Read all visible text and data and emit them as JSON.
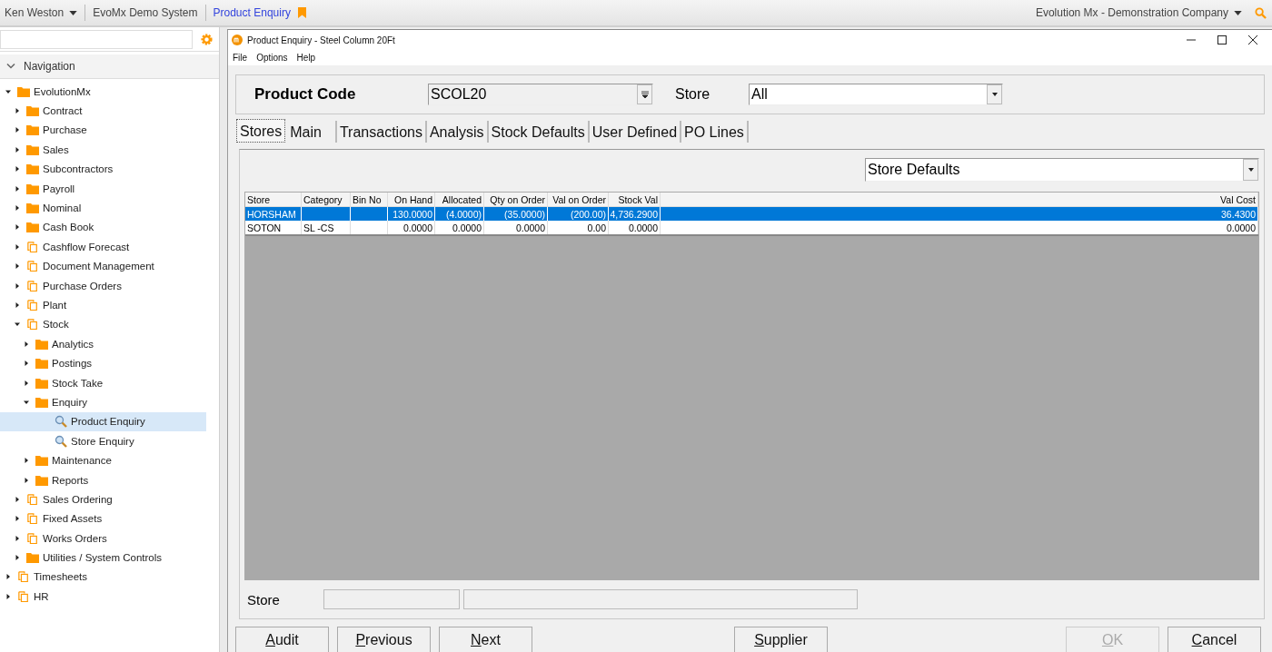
{
  "top_bar": {
    "user": "Ken Weston",
    "system": "EvoMx Demo System",
    "current": "Product Enquiry",
    "company": "Evolution Mx - Demonstration Company"
  },
  "sidebar": {
    "header": "Navigation",
    "tree": [
      {
        "label": "EvolutionMx",
        "kind": "folder",
        "expanded": true,
        "selected": false,
        "children": [
          {
            "label": "Contract",
            "kind": "folder",
            "expanded": false,
            "selected": false
          },
          {
            "label": "Purchase",
            "kind": "folder",
            "expanded": false,
            "selected": false
          },
          {
            "label": "Sales",
            "kind": "folder",
            "expanded": false,
            "selected": false
          },
          {
            "label": "Subcontractors",
            "kind": "folder",
            "expanded": false,
            "selected": false
          },
          {
            "label": "Payroll",
            "kind": "folder",
            "expanded": false,
            "selected": false
          },
          {
            "label": "Nominal",
            "kind": "folder",
            "expanded": false,
            "selected": false
          },
          {
            "label": "Cash Book",
            "kind": "folder",
            "expanded": false,
            "selected": false
          },
          {
            "label": "Cashflow Forecast",
            "kind": "module",
            "expanded": false,
            "selected": false
          },
          {
            "label": "Document Management",
            "kind": "module",
            "expanded": false,
            "selected": false
          },
          {
            "label": "Purchase Orders",
            "kind": "module",
            "expanded": false,
            "selected": false
          },
          {
            "label": "Plant",
            "kind": "module",
            "expanded": false,
            "selected": false
          },
          {
            "label": "Stock",
            "kind": "module",
            "expanded": true,
            "selected": false,
            "children": [
              {
                "label": "Analytics",
                "kind": "folder",
                "expanded": false,
                "selected": false
              },
              {
                "label": "Postings",
                "kind": "folder",
                "expanded": false,
                "selected": false
              },
              {
                "label": "Stock Take",
                "kind": "folder",
                "expanded": false,
                "selected": false
              },
              {
                "label": "Enquiry",
                "kind": "folder",
                "expanded": true,
                "selected": false,
                "children": [
                  {
                    "label": "Product Enquiry",
                    "kind": "search",
                    "selected": true
                  },
                  {
                    "label": "Store Enquiry",
                    "kind": "search",
                    "selected": false
                  }
                ]
              },
              {
                "label": "Maintenance",
                "kind": "folder",
                "expanded": false,
                "selected": false
              },
              {
                "label": "Reports",
                "kind": "folder",
                "expanded": false,
                "selected": false
              }
            ]
          },
          {
            "label": "Sales Ordering",
            "kind": "module",
            "expanded": false,
            "selected": false
          },
          {
            "label": "Fixed Assets",
            "kind": "module",
            "expanded": false,
            "selected": false
          },
          {
            "label": "Works Orders",
            "kind": "module",
            "expanded": false,
            "selected": false
          },
          {
            "label": "Utilities / System Controls",
            "kind": "folder",
            "expanded": false,
            "selected": false
          }
        ]
      },
      {
        "label": "Timesheets",
        "kind": "module",
        "expanded": false,
        "selected": false
      },
      {
        "label": "HR",
        "kind": "module",
        "expanded": false,
        "selected": false
      }
    ]
  },
  "window": {
    "title": "Product Enquiry - Steel Column 20Ft",
    "menu": [
      "File",
      "Options",
      "Help"
    ],
    "product_code": {
      "label": "Product Code",
      "value": "SCOL20"
    },
    "store": {
      "label": "Store",
      "value": "All"
    },
    "tabs": [
      {
        "label": "Stores",
        "selected": true
      },
      {
        "label": "Main",
        "selected": false
      },
      {
        "label": "Transactions",
        "selected": false
      },
      {
        "label": "Analysis",
        "selected": false
      },
      {
        "label": "Stock Defaults",
        "selected": false
      },
      {
        "label": "User Defined",
        "selected": false
      },
      {
        "label": "PO Lines",
        "selected": false
      }
    ],
    "view_select": "Store Defaults",
    "table": {
      "columns": [
        "Store",
        "Category",
        "Bin No",
        "On Hand",
        "Allocated",
        "Qty on Order",
        "Val on Order",
        "Stock Val",
        "Val Cost"
      ],
      "rows": [
        {
          "selected": true,
          "cells": [
            "HORSHAM",
            "",
            "",
            "130.0000",
            "(4.0000)",
            "(35.0000)",
            "(200.00)",
            "4,736.2900",
            "36.4300"
          ]
        },
        {
          "selected": false,
          "cells": [
            "SOTON",
            "SL -CS",
            "",
            "0.0000",
            "0.0000",
            "0.0000",
            "0.00",
            "0.0000",
            "0.0000"
          ]
        }
      ]
    },
    "store_label": "Store",
    "buttons": [
      {
        "label": "Audit",
        "disabled": false
      },
      {
        "label": "Previous",
        "disabled": false
      },
      {
        "label": "Next",
        "disabled": false
      },
      {
        "label": "Supplier",
        "disabled": false
      },
      {
        "label": "OK",
        "disabled": true
      },
      {
        "label": "Cancel",
        "disabled": false
      }
    ]
  }
}
